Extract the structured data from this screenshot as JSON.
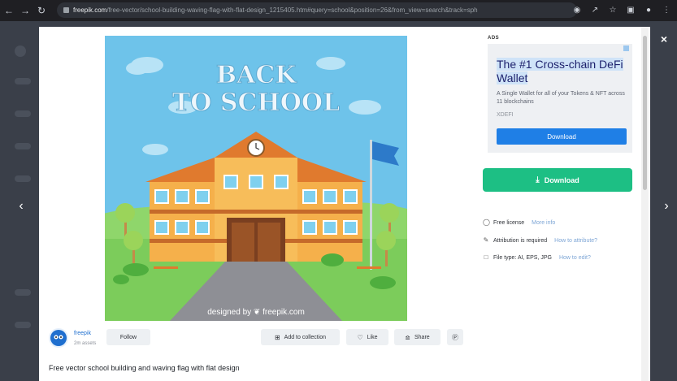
{
  "browser": {
    "url_domain": "freepik.com",
    "url_path": "/free-vector/school-building-waving-flag-with-flat-design_1215405.htm#query=school&position=26&from_view=search&track=sph",
    "back_icon": "arrow-left-icon",
    "forward_icon": "arrow-right-icon",
    "reload_icon": "reload-icon"
  },
  "image": {
    "headline_line1": "BACK",
    "headline_line2": "TO SCHOOL",
    "watermark": "designed by ❦ freepik.com"
  },
  "ad": {
    "label": "ADS",
    "title": "The #1 Cross-chain DeFi Wallet",
    "text": "A Single Wallet for all of your Tokens & NFT across 11 blockchains",
    "brand": "XDEFI",
    "button": "Download"
  },
  "download": {
    "label": "Download"
  },
  "info": [
    {
      "text": "Free license",
      "link": "More info",
      "icon": "shield-icon"
    },
    {
      "text": "Attribution is required",
      "link": "How to attribute?",
      "icon": "pen-icon"
    },
    {
      "text": "File type: AI, EPS, JPG",
      "link": "How to edit?",
      "icon": "file-icon"
    }
  ],
  "author": {
    "name": "freepik",
    "assets": "2m assets",
    "follow": "Follow"
  },
  "actions": {
    "collection": "Add to collection",
    "like": "Like",
    "share": "Share"
  },
  "title": "Free vector school building and waving flag with flat design",
  "colors": {
    "primary_green": "#1dbf84",
    "ad_blue": "#1f7fe6",
    "sky": "#6ec3ea"
  }
}
